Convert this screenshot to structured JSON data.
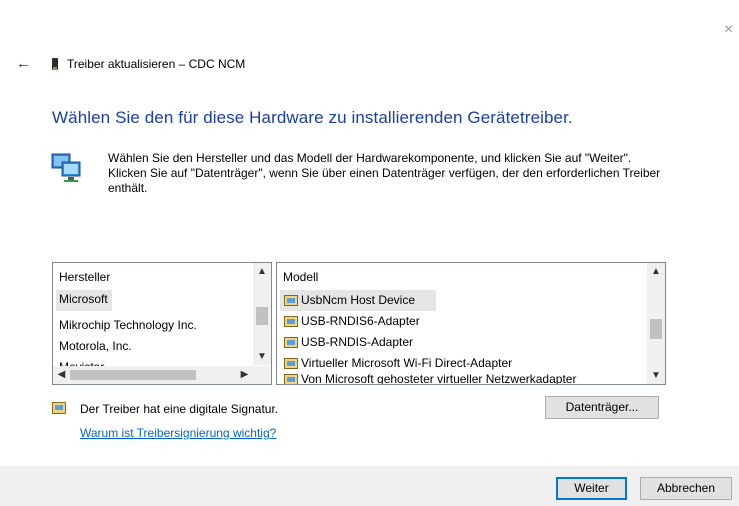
{
  "window": {
    "title": "Treiber aktualisieren – CDC NCM",
    "close_glyph": "×",
    "back_glyph": "←"
  },
  "heading": "Wählen Sie den für diese Hardware zu installierenden Gerätetreiber.",
  "description": "Wählen Sie den Hersteller und das Modell der Hardwarekomponente, und klicken Sie auf \"Weiter\". Klicken Sie auf \"Datenträger\", wenn Sie über einen Datenträger verfügen, der den erforderlichen Treiber enthält.",
  "manufacturers": {
    "header": "Hersteller",
    "items": [
      "Microsoft",
      "Mikrochip Technology Inc.",
      "Motorola, Inc.",
      "Movistar"
    ],
    "selected": "Microsoft"
  },
  "models": {
    "header": "Modell",
    "items": [
      "UsbNcm Host Device",
      "USB-RNDIS6-Adapter",
      "USB-RNDIS-Adapter",
      "Virtueller Microsoft Wi-Fi Direct-Adapter",
      "Von Microsoft gehosteter virtueller Netzwerkadapter"
    ],
    "selected": "UsbNcm Host Device"
  },
  "signature": {
    "text": "Der Treiber hat eine digitale Signatur.",
    "link": "Warum ist Treibersignierung wichtig?"
  },
  "buttons": {
    "have_disk": "Datenträger...",
    "next": "Weiter",
    "cancel": "Abbrechen"
  },
  "colors": {
    "heading": "#1a3ea8",
    "link": "#0066cc",
    "accent": "#0078d7"
  }
}
